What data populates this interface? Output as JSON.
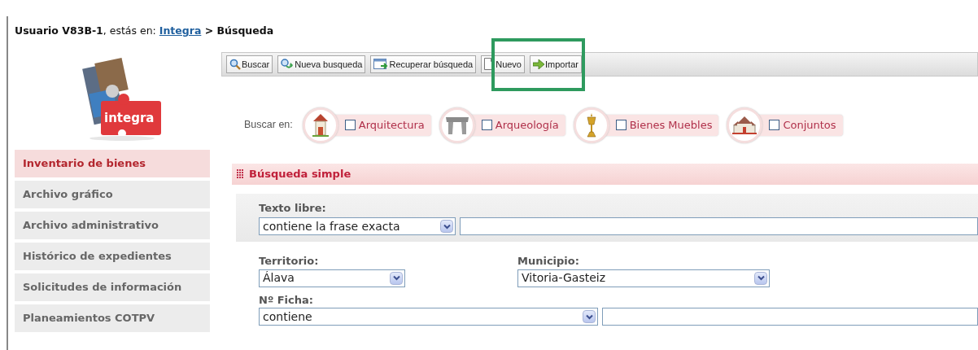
{
  "breadcrumb": {
    "user_label": "Usuario V83B-1",
    "separator_text": ", estás en: ",
    "link": "Integra",
    "arrow": " > ",
    "current": "Búsqueda"
  },
  "logo": {
    "text": "integra"
  },
  "sidebar": {
    "items": [
      {
        "label": "Inventario de bienes",
        "selected": true
      },
      {
        "label": "Archivo gráfico",
        "selected": false
      },
      {
        "label": "Archivo administrativo",
        "selected": false
      },
      {
        "label": "Histórico de expedientes",
        "selected": false
      },
      {
        "label": "Solicitudes de información",
        "selected": false
      },
      {
        "label": "Planeamientos COTPV",
        "selected": false
      }
    ]
  },
  "toolbar": {
    "buttons": [
      {
        "label": "Buscar",
        "kind": "search"
      },
      {
        "label": "Nueva busqueda",
        "kind": "new-search"
      },
      {
        "label": "Recuperar búsqueda",
        "kind": "recover"
      },
      {
        "label": "Nuevo",
        "kind": "new"
      },
      {
        "label": "Importar",
        "kind": "import"
      }
    ]
  },
  "search_in": {
    "label": "Buscar en:",
    "options": [
      {
        "label": "Arquitectura",
        "kind": "house",
        "checked": false
      },
      {
        "label": "Arqueología",
        "kind": "dolmen",
        "checked": false
      },
      {
        "label": "Bienes Muebles",
        "kind": "chalice",
        "checked": false
      },
      {
        "label": "Conjuntos",
        "kind": "church",
        "checked": false
      }
    ]
  },
  "section": {
    "title": "Búsqueda simple"
  },
  "form": {
    "free_text": {
      "label": "Texto libre:",
      "operator": "contiene la frase exacta"
    },
    "territory": {
      "label": "Territorio:",
      "value": "Álava"
    },
    "municipality": {
      "label": "Municipio:",
      "value": "Vitoria-Gasteiz"
    },
    "record_number": {
      "label": "Nº Ficha:",
      "operator": "contiene"
    }
  }
}
